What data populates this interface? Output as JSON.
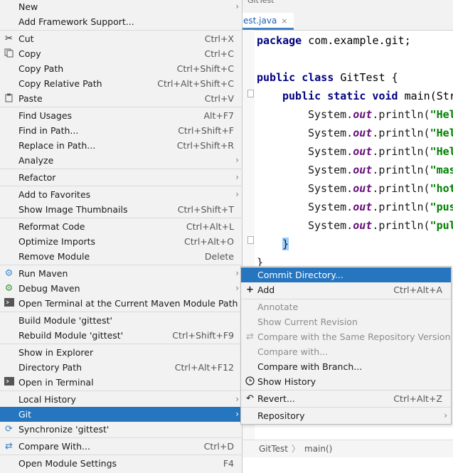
{
  "editor": {
    "tab_top": "GitTest",
    "tab_java": "est.java",
    "tab_close": "×",
    "code": {
      "l1_kw": "package",
      "l1_rest": " com.example.git;",
      "l2_kw": "public class",
      "l2_rest": " GitTest {",
      "l3_kw": "public static void",
      "l3_rest": " main(Str",
      "println_prefix": "System.",
      "out": "out",
      "println_call": ".println(",
      "strings": [
        "\"Hel",
        "\"Hel",
        "\"Hel",
        "\"mas",
        "\"hot",
        "\"pus",
        "\"pul"
      ],
      "close_brace": "}",
      "class_close": "}"
    },
    "breadcrumb": {
      "class": "GitTest",
      "sep": "〉",
      "method": "main()"
    }
  },
  "menu": {
    "new": {
      "label": "New"
    },
    "add_framework": {
      "label": "Add Framework Support..."
    },
    "cut": {
      "label": "Cut",
      "shortcut": "Ctrl+X"
    },
    "copy": {
      "label": "Copy",
      "shortcut": "Ctrl+C"
    },
    "copy_path": {
      "label": "Copy Path",
      "shortcut": "Ctrl+Shift+C"
    },
    "copy_relative_path": {
      "label": "Copy Relative Path",
      "shortcut": "Ctrl+Alt+Shift+C"
    },
    "paste": {
      "label": "Paste",
      "shortcut": "Ctrl+V"
    },
    "find_usages": {
      "label": "Find Usages",
      "shortcut": "Alt+F7"
    },
    "find_in_path": {
      "label": "Find in Path...",
      "shortcut": "Ctrl+Shift+F"
    },
    "replace_in_path": {
      "label": "Replace in Path...",
      "shortcut": "Ctrl+Shift+R"
    },
    "analyze": {
      "label": "Analyze"
    },
    "refactor": {
      "label": "Refactor"
    },
    "add_to_favorites": {
      "label": "Add to Favorites"
    },
    "show_thumbnails": {
      "label": "Show Image Thumbnails",
      "shortcut": "Ctrl+Shift+T"
    },
    "reformat_code": {
      "label": "Reformat Code",
      "shortcut": "Ctrl+Alt+L"
    },
    "optimize_imports": {
      "label": "Optimize Imports",
      "shortcut": "Ctrl+Alt+O"
    },
    "remove_module": {
      "label": "Remove Module",
      "shortcut": "Delete"
    },
    "run_maven": {
      "label": "Run Maven"
    },
    "debug_maven": {
      "label": "Debug Maven"
    },
    "open_terminal_maven": {
      "label": "Open Terminal at the Current Maven Module Path"
    },
    "build_module": {
      "label": "Build Module 'gittest'"
    },
    "rebuild_module": {
      "label": "Rebuild Module 'gittest'",
      "shortcut": "Ctrl+Shift+F9"
    },
    "show_in_explorer": {
      "label": "Show in Explorer"
    },
    "directory_path": {
      "label": "Directory Path",
      "shortcut": "Ctrl+Alt+F12"
    },
    "open_in_terminal": {
      "label": "Open in Terminal"
    },
    "local_history": {
      "label": "Local History"
    },
    "git": {
      "label": "Git"
    },
    "synchronize": {
      "label": "Synchronize 'gittest'"
    },
    "compare_with": {
      "label": "Compare With...",
      "shortcut": "Ctrl+D"
    },
    "open_module_settings": {
      "label": "Open Module Settings",
      "shortcut": "F4"
    }
  },
  "git_submenu": {
    "commit_directory": {
      "label": "Commit Directory..."
    },
    "add": {
      "label": "Add",
      "shortcut": "Ctrl+Alt+A"
    },
    "annotate": {
      "label": "Annotate"
    },
    "show_current_revision": {
      "label": "Show Current Revision"
    },
    "compare_same_repo": {
      "label": "Compare with the Same Repository Version"
    },
    "compare_with": {
      "label": "Compare with..."
    },
    "compare_with_branch": {
      "label": "Compare with Branch..."
    },
    "show_history": {
      "label": "Show History"
    },
    "revert": {
      "label": "Revert...",
      "shortcut": "Ctrl+Alt+Z"
    },
    "repository": {
      "label": "Repository"
    }
  },
  "colors": {
    "selection": "#2675bf",
    "keyword": "#000080",
    "string": "#008000",
    "field": "#660e7a"
  }
}
